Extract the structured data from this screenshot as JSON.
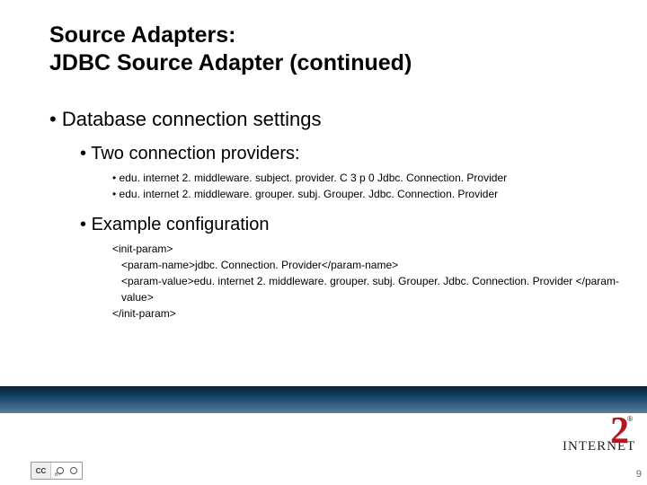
{
  "title_line1": "Source Adapters:",
  "title_line2": "JDBC Source Adapter (continued)",
  "bullet1": "Database connection settings",
  "bullet2a": "Two connection providers:",
  "provider1": "edu. internet 2. middleware. subject. provider. C 3 p 0 Jdbc. Connection. Provider",
  "provider2": "edu. internet 2. middleware. grouper. subj. Grouper. Jdbc. Connection. Provider",
  "bullet2b": "Example configuration",
  "cfg1": "<init-param>",
  "cfg2": "<param-name>jdbc. Connection. Provider</param-name>",
  "cfg3": "<param-value>edu. internet 2. middleware. grouper. subj. Grouper. Jdbc. Connection. Provider </param-value>",
  "cfg4": "</init-param>",
  "logo_text": "INTERNET",
  "logo_numeral": "2",
  "logo_reg": "®",
  "page_number": "9",
  "cc_label": "CC",
  "cc_by": "BY"
}
